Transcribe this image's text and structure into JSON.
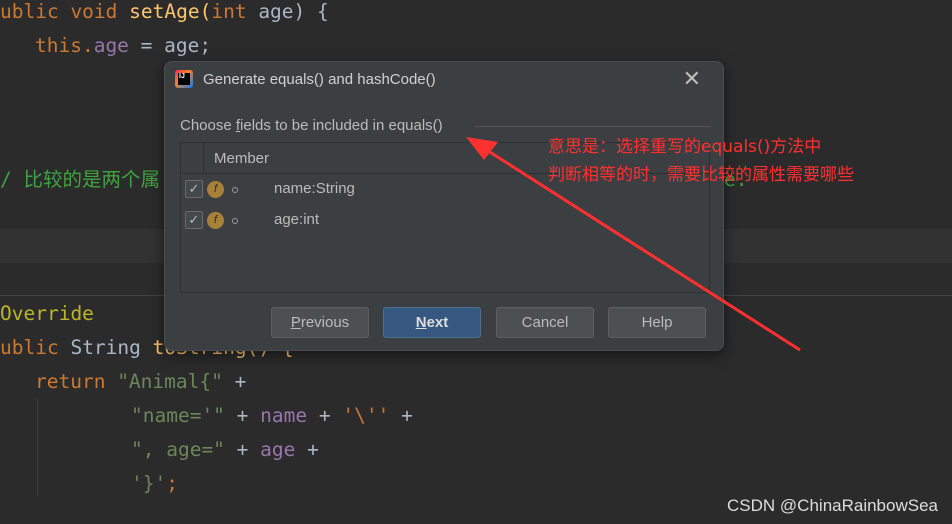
{
  "editor": {
    "line1": {
      "a": "ublic void ",
      "b": "setAge",
      "c": "(",
      "d": "int ",
      "e": "age) {"
    },
    "line2": {
      "a": "this.",
      "b": "age",
      "c": " = age;"
    },
    "comment_visible": "/ 比较的是两个属",
    "comment_tail": "e.",
    "annotation": "Override",
    "line6": {
      "a": "ublic ",
      "b": "String ",
      "c": "toString() {"
    },
    "line7": {
      "a": "return ",
      "b": "\"Animal{\"",
      "c": " +"
    },
    "line8": {
      "a": "\"name='\"",
      "b": " + ",
      "c": "name",
      "d": " + ",
      "e": "'\\''",
      "f": " +"
    },
    "line9": {
      "a": "\", age=\"",
      "b": " + ",
      "c": "age",
      "d": " +"
    },
    "line10": {
      "a": "'}'",
      "b": ";"
    }
  },
  "dialog": {
    "title": "Generate equals() and hashCode()",
    "close_icon": "close-icon",
    "choose_prefix": "Choose ",
    "choose_mnemonic": "f",
    "choose_rest": "ields to be included in equals()",
    "column_header": "Member",
    "fields": [
      {
        "label": "name:String",
        "checked": true
      },
      {
        "label": "age:int",
        "checked": true
      }
    ],
    "buttons": {
      "previous": "Previous",
      "next": "Next",
      "cancel": "Cancel",
      "help": "Help"
    }
  },
  "annotation_note": {
    "line1": "意思是：选择重写的equals()方法中",
    "line2": "判断相等的时，需要比较的属性需要哪些",
    "color": "#ff3030"
  },
  "watermark": "CSDN @ChinaRainbowSea"
}
